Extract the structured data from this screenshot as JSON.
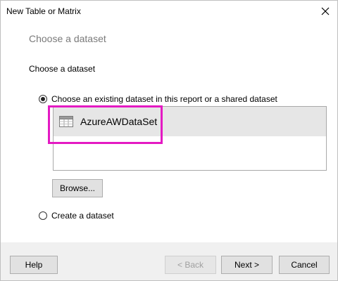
{
  "window": {
    "title": "New Table or Matrix"
  },
  "page": {
    "heading": "Choose a dataset",
    "section_label": "Choose a dataset"
  },
  "options": {
    "existing_label": "Choose an existing dataset in this report or a shared dataset",
    "existing_selected": true,
    "create_label": "Create a dataset",
    "create_selected": false
  },
  "datasets": [
    {
      "name": "AzureAWDataSet",
      "icon": "table-icon",
      "selected": true
    }
  ],
  "buttons": {
    "browse": "Browse...",
    "help": "Help",
    "back": "< Back",
    "next": "Next >",
    "cancel": "Cancel"
  },
  "colors": {
    "highlight": "#e41ac3",
    "selected_row": "#e6e6e6",
    "footer": "#f0f0f0"
  }
}
